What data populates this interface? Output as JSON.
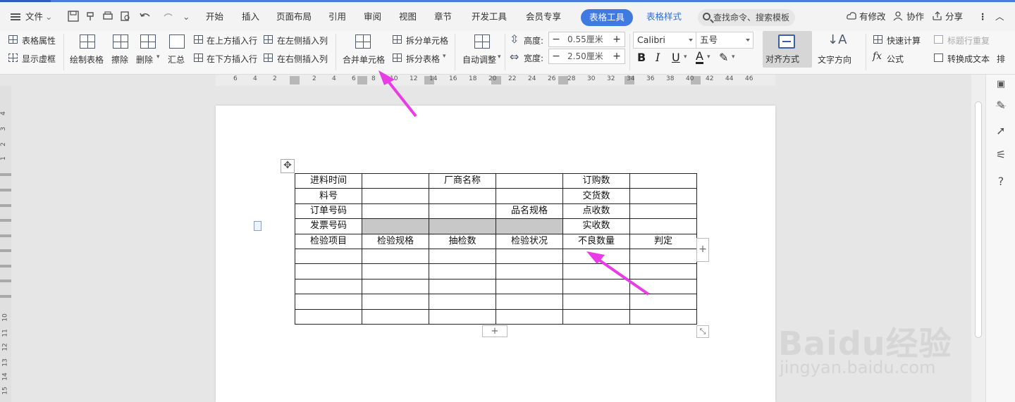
{
  "menubar": {
    "file_label": "文件",
    "tabs": [
      "开始",
      "插入",
      "页面布局",
      "引用",
      "审阅",
      "视图",
      "章节",
      "开发工具",
      "会员专享"
    ],
    "active_tab": "表格工具",
    "secondary_tab": "表格样式",
    "search_placeholder": "查找命令、搜索模板",
    "right_items": [
      "有修改",
      "协作",
      "分享"
    ]
  },
  "ribbon": {
    "table_props": "表格属性",
    "show_gridlines": "显示虚框",
    "draw_table": "绘制表格",
    "erase": "擦除",
    "delete": "删除",
    "summary": "汇总",
    "insert_above": "在上方插入行",
    "insert_below": "在下方插入行",
    "insert_left": "在左侧插入列",
    "insert_right": "在右侧插入列",
    "merge_cells": "合并单元格",
    "split_cells": "拆分单元格",
    "split_table": "拆分表格",
    "auto_fit": "自动调整",
    "height_label": "高度:",
    "height_value": "0.55厘米",
    "width_label": "宽度:",
    "width_value": "2.50厘米",
    "font_name": "Calibri",
    "font_size": "五号",
    "align": "对齐方式",
    "text_direction": "文字方向",
    "quick_calc": "快速计算",
    "formula": "公式",
    "repeat_header": "标题行重复",
    "convert_text": "转换成文本",
    "sort_partial": "排"
  },
  "ruler": {
    "ticks": [
      "6",
      "4",
      "2",
      "2",
      "4",
      "6",
      "8",
      "10",
      "12",
      "14",
      "16",
      "18",
      "20",
      "22",
      "24",
      "26",
      "28",
      "30",
      "32",
      "34",
      "36",
      "38",
      "40",
      "42",
      "44",
      "46"
    ],
    "vticks": [
      "4",
      "3",
      "2",
      "1",
      "10",
      "11",
      "12",
      "13",
      "14",
      "15"
    ]
  },
  "table": {
    "rows": [
      [
        "进料时间",
        "",
        "厂商名称",
        "",
        "订购数",
        ""
      ],
      [
        "料号",
        "",
        "",
        "",
        "交货数",
        ""
      ],
      [
        "订单号码",
        "",
        "",
        "品名规格",
        "点收数",
        ""
      ],
      [
        "发票号码",
        "",
        "",
        "",
        "实收数",
        ""
      ],
      [
        "检验项目",
        "检验规格",
        "抽检数",
        "检验状况",
        "不良数量",
        "判定"
      ],
      [
        "",
        "",
        "",
        "",
        "",
        ""
      ],
      [
        "",
        "",
        "",
        "",
        "",
        ""
      ],
      [
        "",
        "",
        "",
        "",
        "",
        ""
      ],
      [
        "",
        "",
        "",
        "",
        "",
        ""
      ],
      [
        "",
        "",
        "",
        "",
        "",
        ""
      ]
    ],
    "gray_cells": [
      [
        3,
        1
      ],
      [
        3,
        2
      ],
      [
        3,
        3
      ]
    ]
  },
  "watermark": {
    "logo": "Baidu经验",
    "url": "jingyan.baidu.com"
  },
  "colors": {
    "accent": "#3f7ae0",
    "arrow": "#e93ce6"
  }
}
